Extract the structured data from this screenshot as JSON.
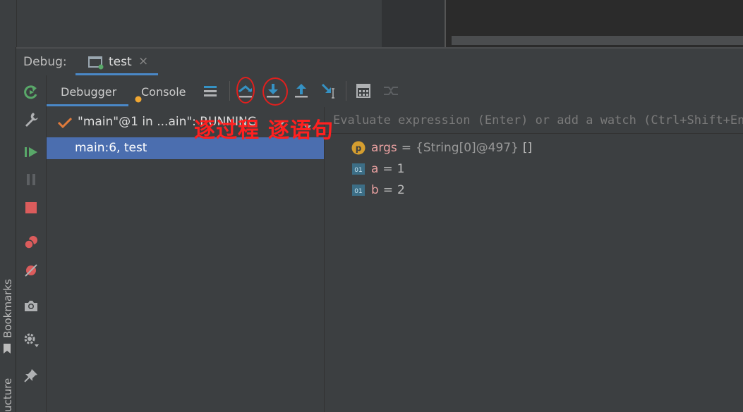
{
  "side_strip": {
    "bookmarks_label": "Bookmarks",
    "structure_label": "ucture"
  },
  "debug_header": {
    "label": "Debug:",
    "session": {
      "name": "test",
      "close": "×"
    }
  },
  "action_bar": {
    "icons": [
      "rerun-icon",
      "settings-wrench-icon",
      "resume-icon",
      "pause-icon",
      "stop-icon",
      "view-breakpoints-icon",
      "mute-breakpoints-icon",
      "camera-icon",
      "settings-gear-icon",
      "pin-icon"
    ]
  },
  "toolbar": {
    "tabs": [
      {
        "label": "Debugger",
        "active": true
      },
      {
        "label": "Console",
        "active": false
      }
    ],
    "buttons": [
      "layout-menu-icon",
      "step-over-icon",
      "step-into-icon",
      "step-out-icon",
      "run-to-cursor-icon",
      "evaluate-expression-icon",
      "trace-current-stream-icon"
    ]
  },
  "frames": {
    "thread": "\"main\"@1 in ...ain\": RUNNING",
    "items": [
      {
        "label": "main:6, test",
        "selected": true
      }
    ]
  },
  "variables": {
    "eval_placeholder": "Evaluate expression (Enter) or add a watch (Ctrl+Shift+Enter)",
    "items": [
      {
        "icon": "parameter-icon",
        "icon_text": "p",
        "name": "args",
        "type": "{String[0]@497}",
        "value": "[]"
      },
      {
        "icon": "primitive-icon",
        "icon_text": "01",
        "name": "a",
        "value": "1"
      },
      {
        "icon": "primitive-icon",
        "icon_text": "01",
        "name": "b",
        "value": "2"
      }
    ]
  },
  "annotations": {
    "step_over_note": "逐过程",
    "step_into_note": "逐语句",
    "color": "#ff2020"
  },
  "colors": {
    "selection": "#4b6eaf",
    "tab_underline": "#4a88c7",
    "variable_name": "#e8a0a0"
  }
}
